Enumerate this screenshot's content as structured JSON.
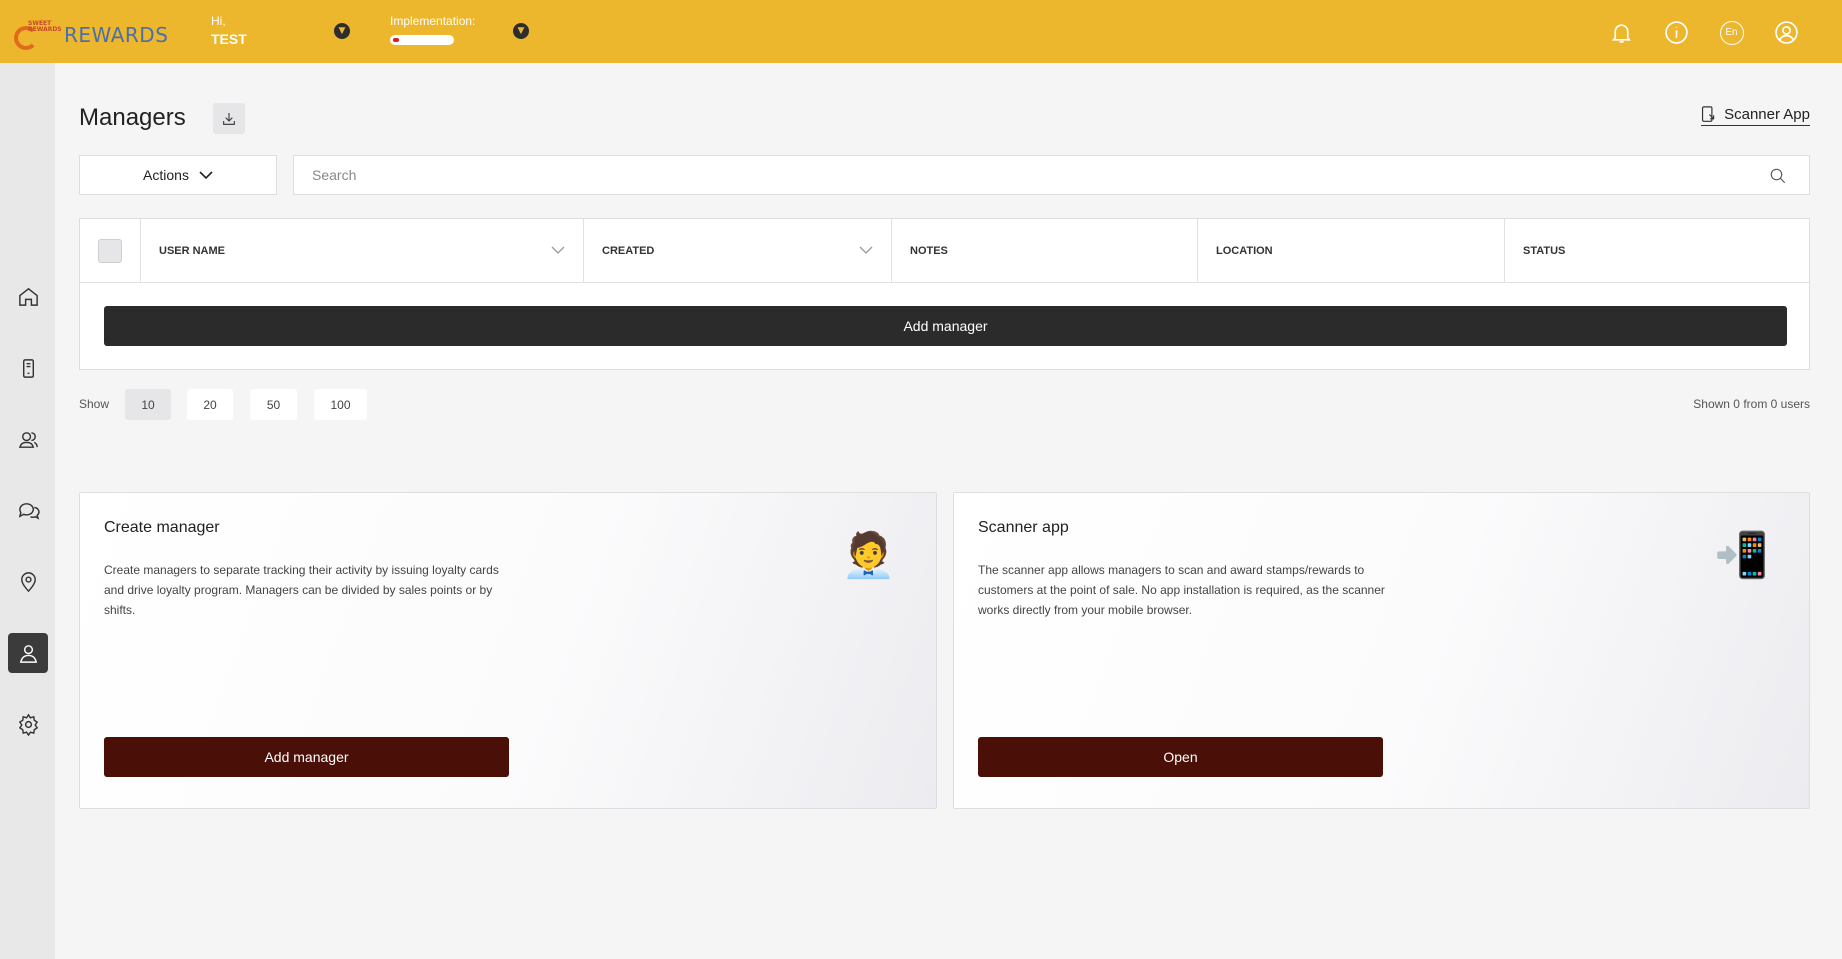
{
  "header": {
    "logo_tiny": "SWEET REWARDS",
    "logo_text": "REWARDS",
    "greeting": "Hi,",
    "user_name": "TEST",
    "implementation_label": "Implementation:",
    "implementation_progress": 0.1,
    "language": "En",
    "icons": [
      "bell-icon",
      "info-icon",
      "language-icon",
      "user-circle-icon"
    ]
  },
  "sidebar": {
    "items": [
      {
        "icon": "home-icon"
      },
      {
        "icon": "device-icon"
      },
      {
        "icon": "users-icon"
      },
      {
        "icon": "chat-icon"
      },
      {
        "icon": "location-icon"
      },
      {
        "icon": "manager-icon",
        "active": true
      },
      {
        "icon": "gear-icon"
      }
    ]
  },
  "page": {
    "title": "Managers",
    "scanner_link": "Scanner App",
    "actions_label": "Actions",
    "search_placeholder": "Search"
  },
  "table": {
    "columns": [
      "USER NAME",
      "CREATED",
      "NOTES",
      "LOCATION",
      "STATUS"
    ],
    "rows": [],
    "add_button": "Add manager"
  },
  "pagination": {
    "show_label": "Show",
    "options": [
      "10",
      "20",
      "50",
      "100"
    ],
    "selected": "10",
    "summary": "Shown 0 from 0 users"
  },
  "cards": [
    {
      "title": "Create manager",
      "description": "Create managers to separate tracking their activity by issuing loyalty cards and drive loyalty program. Managers can be divided by sales points or by shifts.",
      "emoji": "🧑‍💼",
      "button": "Add manager"
    },
    {
      "title": "Scanner app",
      "description": "The scanner app allows managers to scan and award stamps/rewards to customers at the point of sale. No app installation is required, as the scanner works directly from your mobile browser.",
      "emoji": "📲",
      "button": "Open"
    }
  ]
}
